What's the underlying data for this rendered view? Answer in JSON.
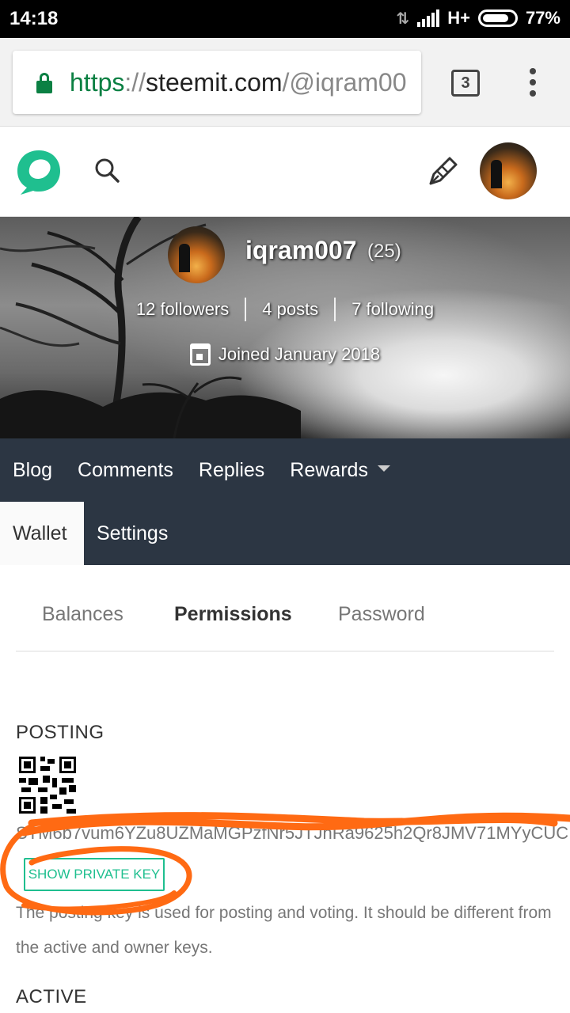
{
  "statusbar": {
    "time": "14:18",
    "network": "H+",
    "battery": "77%"
  },
  "browser": {
    "url_scheme": "https",
    "url_sep": "://",
    "url_host": "steemit.com",
    "url_path": "/@iqram00",
    "tab_count": "3"
  },
  "profile": {
    "name": "iqram007",
    "reputation": "(25)",
    "followers": "12 followers",
    "posts": "4 posts",
    "following": "7 following",
    "joined": "Joined January 2018"
  },
  "nav": {
    "blog": "Blog",
    "comments": "Comments",
    "replies": "Replies",
    "rewards": "Rewards",
    "wallet": "Wallet",
    "settings": "Settings"
  },
  "wallet_tabs": {
    "balances": "Balances",
    "permissions": "Permissions",
    "password": "Password"
  },
  "posting": {
    "label": "POSTING",
    "public_key": "STM6b7vum6YZu8UZMaMGPzfNr5JTJnRa9625h2Qr8JMV71MYyCUC",
    "show_button": "SHOW PRIVATE KEY",
    "description": "The posting key is used for posting and voting. It should be different from the active and owner keys."
  },
  "active": {
    "label": "ACTIVE"
  },
  "colors": {
    "accent": "#1fbf8f",
    "nav_bg": "#2c3643",
    "annotation": "#ff6a13"
  }
}
